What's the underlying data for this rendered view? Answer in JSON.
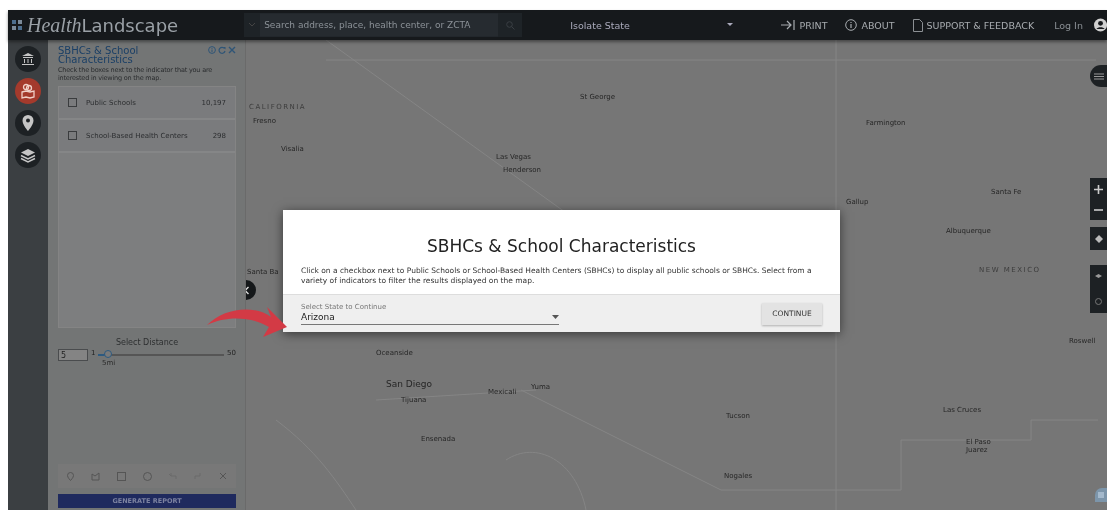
{
  "header": {
    "logo": {
      "part_1": "Health",
      "part_2": "Landscape"
    },
    "search": {
      "placeholder": "Search address, place, health center, or ZCTA"
    },
    "state_select": {
      "value": "Isolate State"
    },
    "nav": [
      {
        "label": "PRINT",
        "kind": "print"
      },
      {
        "label": "ABOUT",
        "kind": "about"
      },
      {
        "label": "SUPPORT & FEEDBACK",
        "kind": "support"
      }
    ],
    "login": "Log In"
  },
  "rail": [
    {
      "kind": "building",
      "selected": false
    },
    {
      "kind": "map",
      "selected": true
    },
    {
      "kind": "pin",
      "selected": false
    },
    {
      "kind": "layers",
      "selected": false
    }
  ],
  "panel": {
    "title": "SBHCs & School Characteristics",
    "description": "Check the boxes next to the indicator that you are interested in viewing on the map.",
    "items": [
      {
        "label": "Public Schools",
        "count": "10,197",
        "checked": false
      },
      {
        "label": "School-Based Health Centers",
        "count": "298",
        "checked": false
      }
    ],
    "distance": {
      "label": "Select Distance",
      "value": "5",
      "min": "1",
      "max": "50",
      "level": 0.08,
      "reading": "5mi"
    },
    "generate_button": "GENERATE REPORT"
  },
  "map": {
    "labels": [
      {
        "text": "CALIFORNIA",
        "kind": "region"
      },
      {
        "text": "Fresno",
        "kind": "city"
      },
      {
        "text": "Visalia",
        "kind": "city"
      },
      {
        "text": "Las Vegas",
        "kind": "city"
      },
      {
        "text": "Henderson",
        "kind": "city"
      },
      {
        "text": "St George",
        "kind": "city"
      },
      {
        "text": "Farmington",
        "kind": "city"
      },
      {
        "text": "Santa Fe",
        "kind": "city"
      },
      {
        "text": "Gallup",
        "kind": "city"
      },
      {
        "text": "Albuquerque",
        "kind": "city"
      },
      {
        "text": "NEW MEXICO",
        "kind": "region"
      },
      {
        "text": "Santa Ba",
        "kind": "city"
      },
      {
        "text": "Roswell",
        "kind": "city"
      },
      {
        "text": "Oceanside",
        "kind": "city"
      },
      {
        "text": "San Diego",
        "kind": "big"
      },
      {
        "text": "Tijuana",
        "kind": "city"
      },
      {
        "text": "Mexicali",
        "kind": "city"
      },
      {
        "text": "Yuma",
        "kind": "city"
      },
      {
        "text": "Tucson",
        "kind": "city"
      },
      {
        "text": "Las Cruces",
        "kind": "city"
      },
      {
        "text": "Ensenada",
        "kind": "city"
      },
      {
        "text": "El Paso",
        "kind": "city"
      },
      {
        "text": "Juarez",
        "kind": "city"
      },
      {
        "text": "Nogales",
        "kind": "city"
      }
    ]
  },
  "modal": {
    "title": "SBHCs & School Characteristics",
    "text": "Click on a checkbox next to Public Schools or School-Based Health Centers (SBHCs) to display all public schools or SBHCs. Select from a variety of indicators to filter the results displayed on the map.",
    "select": {
      "label": "Select State to Continue",
      "value": "Arizona"
    },
    "button": "CONTINUE"
  }
}
